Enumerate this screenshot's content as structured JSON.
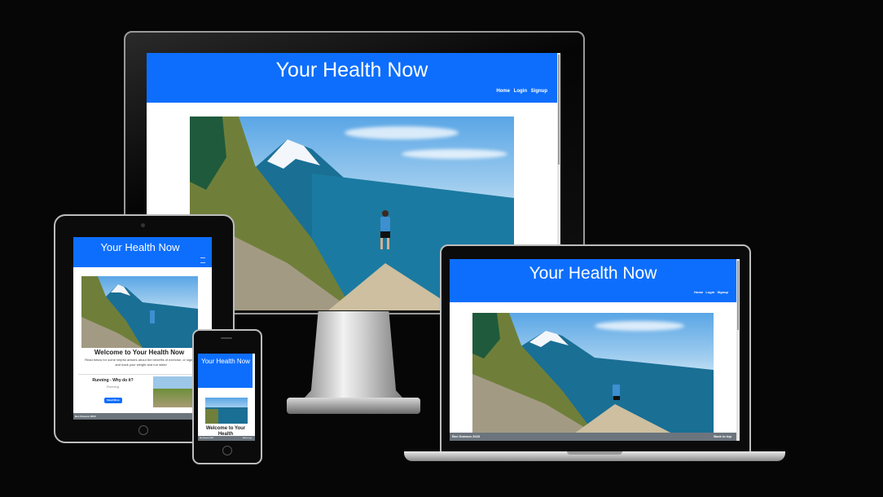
{
  "site": {
    "title": "Your Health Now",
    "nav": [
      "Home",
      "Login",
      "Signup"
    ],
    "welcome": "Welcome to Your Health Now",
    "welcome_phone": "Welcome to Your Health",
    "intro": "Read below for some helpful articles about the benefits of exercise, or sign up and track your weight and run stats!",
    "article": {
      "title": "Running - Why do it?",
      "subtitle": "Running",
      "button": "Read More"
    },
    "footer_left": "Bex Dowson 2023",
    "footer_right": "Back to top"
  },
  "colors": {
    "brand_blue": "#0d6efd",
    "footer_gray": "#6c757d",
    "background": "#060606"
  }
}
